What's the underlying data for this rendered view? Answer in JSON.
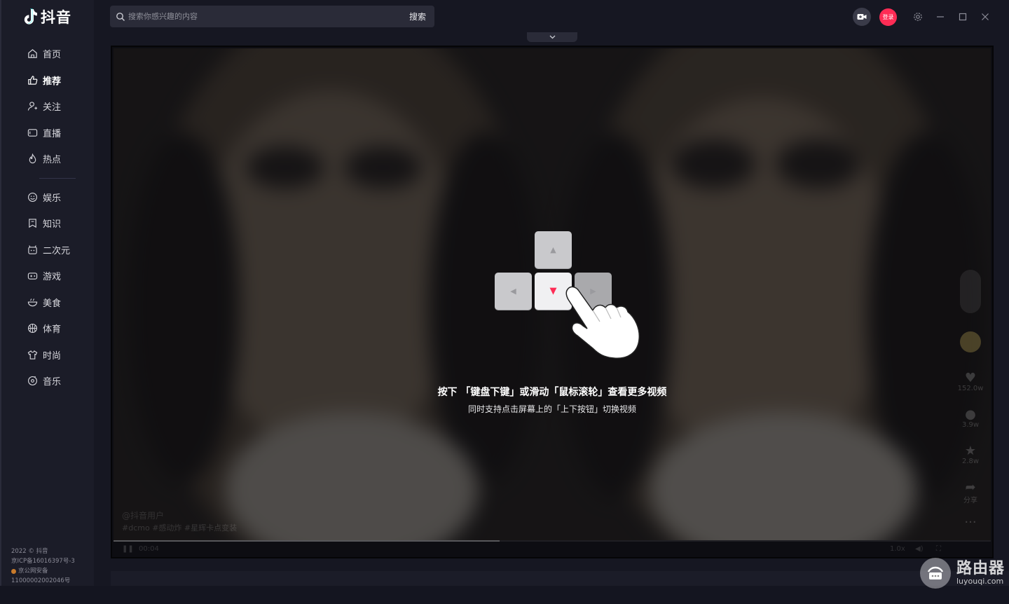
{
  "app": {
    "name": "抖音"
  },
  "search": {
    "placeholder": "搜索你感兴趣的内容",
    "button": "搜索"
  },
  "header": {
    "login_label": "登录"
  },
  "sidebar": {
    "items": [
      {
        "label": "首页",
        "icon": "home-icon"
      },
      {
        "label": "推荐",
        "icon": "thumbs-up-icon",
        "active": true
      },
      {
        "label": "关注",
        "icon": "follow-user-icon"
      },
      {
        "label": "直播",
        "icon": "live-tv-icon"
      },
      {
        "label": "热点",
        "icon": "flame-icon"
      }
    ],
    "categories": [
      {
        "label": "娱乐",
        "icon": "smile-icon"
      },
      {
        "label": "知识",
        "icon": "book-icon"
      },
      {
        "label": "二次元",
        "icon": "anime-icon"
      },
      {
        "label": "游戏",
        "icon": "gamepad-icon"
      },
      {
        "label": "美食",
        "icon": "bowl-icon"
      },
      {
        "label": "体育",
        "icon": "ball-icon"
      },
      {
        "label": "时尚",
        "icon": "shirt-icon"
      },
      {
        "label": "音乐",
        "icon": "music-disc-icon"
      }
    ],
    "footer": {
      "copyright": "2022 © 抖音",
      "icp": "京ICP备16016397号-3",
      "police": "京公网安备",
      "police_no": "11000002002046号"
    }
  },
  "player": {
    "hint_main": "按下 「键盘下键」或滑动「鼠标滚轮」查看更多视频",
    "hint_sub": "同时支持点击屏幕上的「上下按钮」切换视频",
    "likes": "152.0w",
    "comments": "3.9w",
    "favorites": "2.8w",
    "share": "分享",
    "tags": "#dcmo  #感动炸  #星辉卡点变装",
    "time": "00:04",
    "speed": "1.0x",
    "progress": 0.44
  },
  "watermark": {
    "title": "路由器",
    "site": "luyouqi.com"
  },
  "colors": {
    "accent": "#fe2c55",
    "background": "#161722",
    "sidebar": "#1b1c28"
  }
}
